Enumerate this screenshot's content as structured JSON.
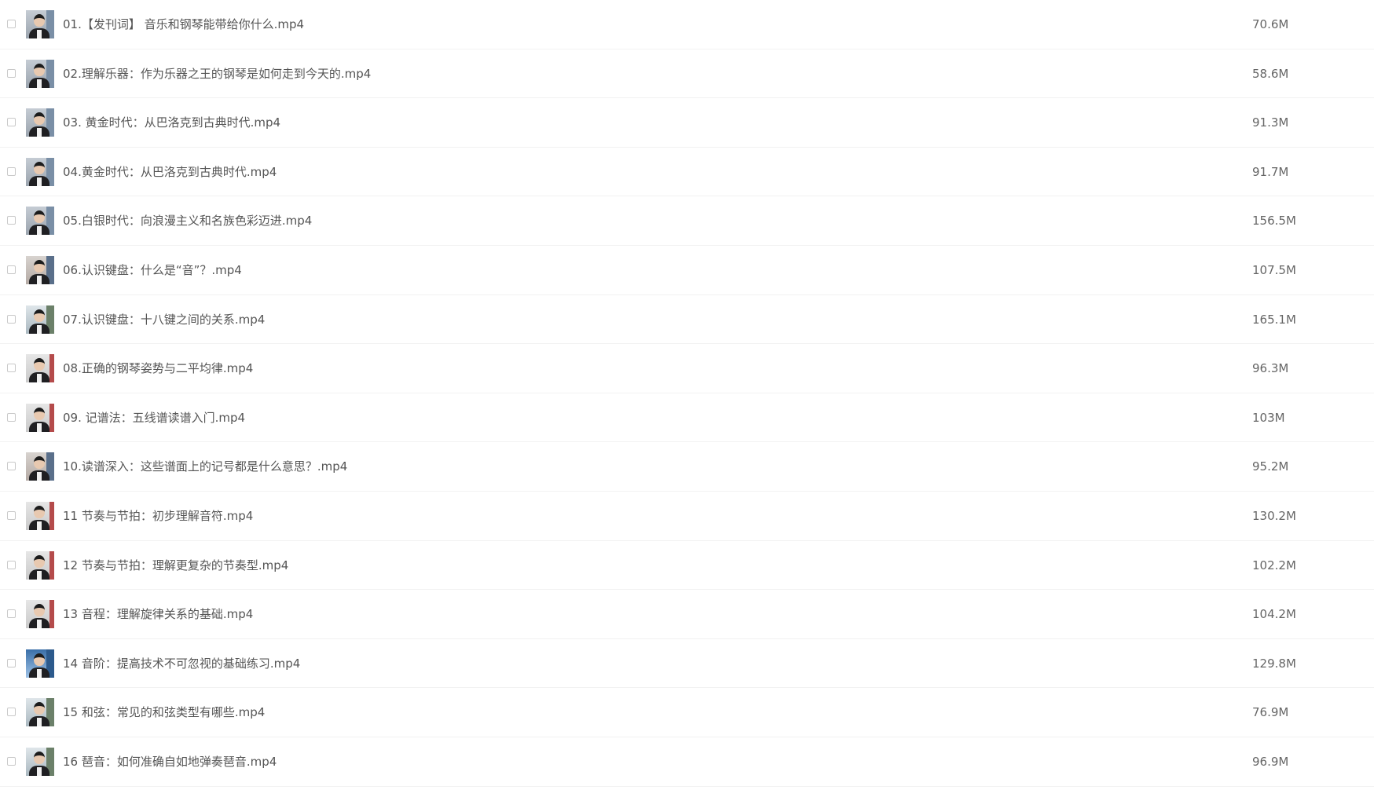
{
  "files": [
    {
      "name": "01.【发刊词】 音乐和钢琴能带给你什么.mp4",
      "size": "70.6M"
    },
    {
      "name": "02.理解乐器：作为乐器之王的钢琴是如何走到今天的.mp4",
      "size": "58.6M"
    },
    {
      "name": "03. 黄金时代：从巴洛克到古典时代.mp4",
      "size": "91.3M"
    },
    {
      "name": "04.黄金时代：从巴洛克到古典时代.mp4",
      "size": "91.7M"
    },
    {
      "name": "05.白银时代：向浪漫主义和名族色彩迈进.mp4",
      "size": "156.5M"
    },
    {
      "name": "06.认识键盘：什么是“音”？.mp4",
      "size": "107.5M"
    },
    {
      "name": "07.认识键盘：十八键之间的关系.mp4",
      "size": "165.1M"
    },
    {
      "name": "08.正确的钢琴姿势与二平均律.mp4",
      "size": "96.3M"
    },
    {
      "name": "09. 记谱法：五线谱读谱入门.mp4",
      "size": "103M"
    },
    {
      "name": "10.读谱深入：这些谱面上的记号都是什么意思？.mp4",
      "size": "95.2M"
    },
    {
      "name": "11 节奏与节拍：初步理解音符.mp4",
      "size": "130.2M"
    },
    {
      "name": "12 节奏与节拍：理解更复杂的节奏型.mp4",
      "size": "102.2M"
    },
    {
      "name": "13 音程：理解旋律关系的基础.mp4",
      "size": "104.2M"
    },
    {
      "name": "14 音阶：提高技术不可忽视的基础练习.mp4",
      "size": "129.8M"
    },
    {
      "name": "15 和弦：常见的和弦类型有哪些.mp4",
      "size": "76.9M"
    },
    {
      "name": "16 琶音：如何准确自如地弹奏琶音.mp4",
      "size": "96.9M"
    }
  ]
}
